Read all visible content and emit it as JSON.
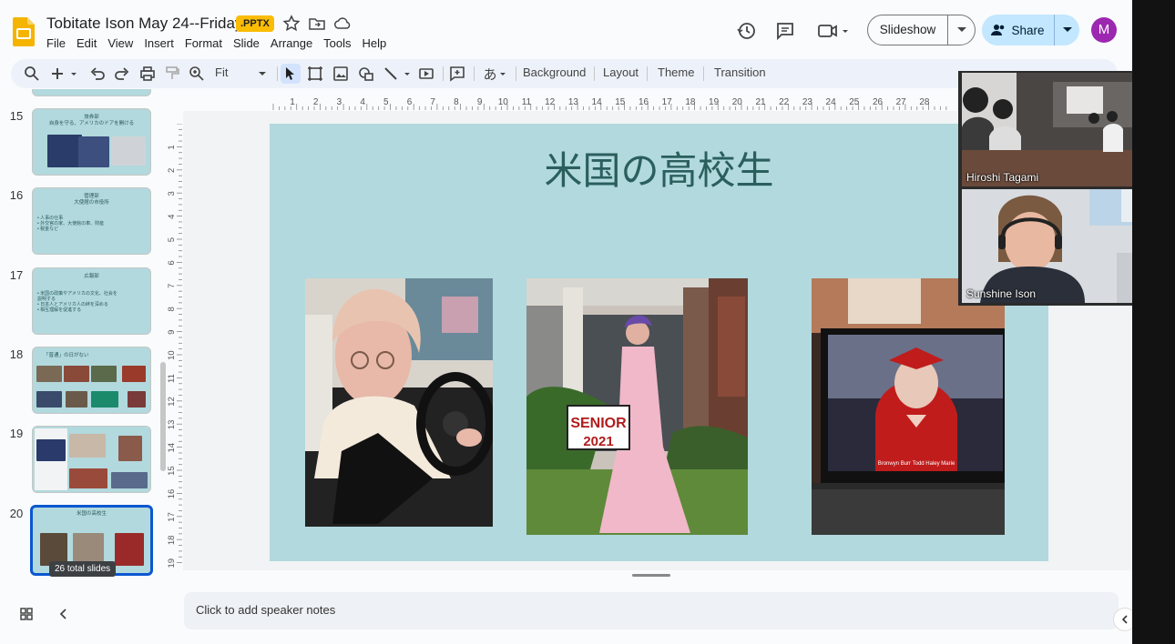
{
  "header": {
    "title": "Tobitate Ison May 24--Friday",
    "format_badge": ".PPTX",
    "menu": [
      "File",
      "Edit",
      "View",
      "Insert",
      "Format",
      "Slide",
      "Arrange",
      "Tools",
      "Help"
    ],
    "slideshow_label": "Slideshow",
    "share_label": "Share",
    "avatar_initial": "M"
  },
  "toolbar": {
    "zoom_value": "Fit",
    "background_label": "Background",
    "layout_label": "Layout",
    "theme_label": "Theme",
    "transition_label": "Transition"
  },
  "filmstrip": {
    "slides": [
      {
        "number": "15",
        "title": "",
        "subtitle": "自身を守る、アメリカのドアを開ける",
        "heading": "旅券部"
      },
      {
        "number": "16",
        "heading": "管理部",
        "title": "大使館の市役所",
        "bullets": [
          "• 人事の仕事",
          "• 外交官の家、大使館の車、財産",
          "• 税金など"
        ]
      },
      {
        "number": "17",
        "heading": "広報部",
        "bullets": [
          "• 米国の政策やアメリカの文化、社会を",
          "  説明する",
          "• 日本人とアメリカ人の絆を深める",
          "• 相互理解を促進する"
        ]
      },
      {
        "number": "18",
        "heading": "「普通」の日がない"
      },
      {
        "number": "19"
      },
      {
        "number": "20",
        "heading": "米国の高校生"
      }
    ],
    "total_slides_tooltip": "26 total slides"
  },
  "rulers": {
    "horizontal": [
      "1",
      "2",
      "3",
      "4",
      "5",
      "6",
      "7",
      "8",
      "9",
      "10",
      "11",
      "12",
      "13",
      "14",
      "15",
      "16",
      "17",
      "18",
      "19",
      "20",
      "21",
      "22",
      "23",
      "24",
      "25",
      "26",
      "27",
      "28"
    ],
    "vertical": [
      "1",
      "2",
      "3",
      "4",
      "5",
      "6",
      "7",
      "8",
      "9",
      "10",
      "11",
      "12",
      "13",
      "14",
      "15",
      "16",
      "17",
      "18",
      "19"
    ]
  },
  "slide": {
    "title": "米国の高校生",
    "photos": [
      {
        "alt": "student-driving-car"
      },
      {
        "alt": "student-senior-2021-sign",
        "sign_line1": "SENIOR",
        "sign_line2": "2021"
      },
      {
        "alt": "graduation-on-laptop",
        "caption": "Bronwyn Burr Todd Haley Marie"
      }
    ]
  },
  "notes": {
    "placeholder": "Click to add speaker notes"
  },
  "video": {
    "participants": [
      {
        "name": "Hiroshi Tagami"
      },
      {
        "name": "Sunshine Ison"
      }
    ]
  },
  "colors": {
    "slide_bg": "#b2d9dd",
    "title": "#2a5f5e",
    "accent": "#0b57d0",
    "share_bg": "#c2e7ff",
    "badge": "#fbbc04"
  }
}
